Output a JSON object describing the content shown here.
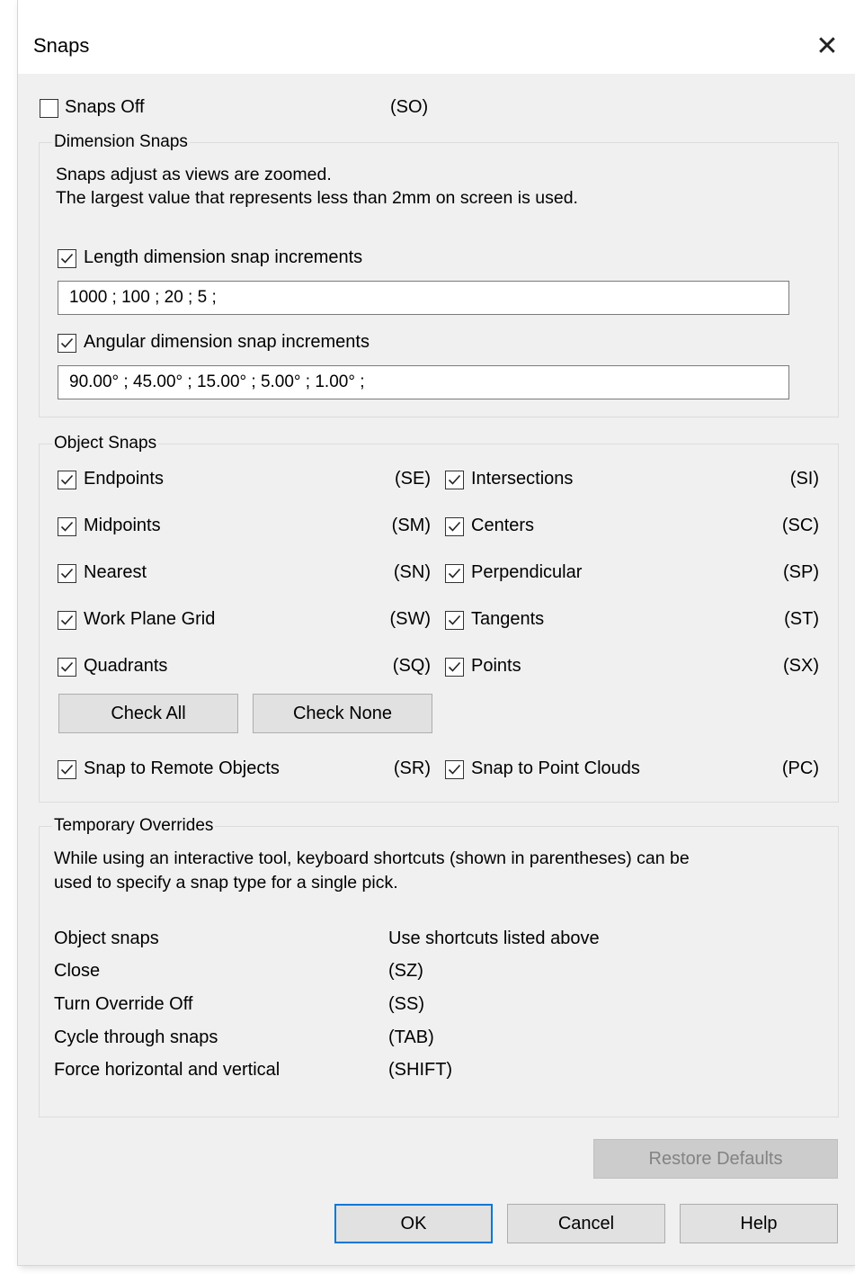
{
  "window": {
    "title": "Snaps",
    "close_glyph": "✕"
  },
  "snaps_off": {
    "label": "Snaps Off",
    "checked": false,
    "shortcut": "(SO)"
  },
  "dimension_snaps": {
    "title": "Dimension Snaps",
    "info_line1": "Snaps adjust as views are zoomed.",
    "info_line2": "The largest value that represents less than 2mm on screen is used.",
    "length": {
      "label": "Length dimension snap increments",
      "checked": true,
      "value": "1000 ; 100 ; 20 ; 5 ;"
    },
    "angular": {
      "label": "Angular dimension snap increments",
      "checked": true,
      "value": "90.00° ; 45.00° ; 15.00° ; 5.00° ; 1.00° ;"
    }
  },
  "object_snaps": {
    "title": "Object Snaps",
    "left": [
      {
        "label": "Endpoints",
        "shortcut": "(SE)",
        "checked": true
      },
      {
        "label": "Midpoints",
        "shortcut": "(SM)",
        "checked": true
      },
      {
        "label": "Nearest",
        "shortcut": "(SN)",
        "checked": true
      },
      {
        "label": "Work Plane Grid",
        "shortcut": "(SW)",
        "checked": true
      },
      {
        "label": "Quadrants",
        "shortcut": "(SQ)",
        "checked": true
      }
    ],
    "right": [
      {
        "label": "Intersections",
        "shortcut": "(SI)",
        "checked": true
      },
      {
        "label": "Centers",
        "shortcut": "(SC)",
        "checked": true
      },
      {
        "label": "Perpendicular",
        "shortcut": "(SP)",
        "checked": true
      },
      {
        "label": "Tangents",
        "shortcut": "(ST)",
        "checked": true
      },
      {
        "label": "Points",
        "shortcut": "(SX)",
        "checked": true
      }
    ],
    "check_all": "Check All",
    "check_none": "Check None",
    "remote": {
      "label": "Snap to Remote Objects",
      "shortcut": "(SR)",
      "checked": true
    },
    "point_clouds": {
      "label": "Snap to Point Clouds",
      "shortcut": "(PC)",
      "checked": true
    }
  },
  "temporary_overrides": {
    "title": "Temporary Overrides",
    "info_line1": "While using an interactive tool, keyboard shortcuts (shown in parentheses) can be",
    "info_line2": "used to specify a snap type for a single pick.",
    "rows": [
      {
        "name": "Object snaps",
        "value": "Use shortcuts listed above"
      },
      {
        "name": "Close",
        "value": "(SZ)"
      },
      {
        "name": "Turn Override Off",
        "value": "(SS)"
      },
      {
        "name": "Cycle through snaps",
        "value": "(TAB)"
      },
      {
        "name": "Force horizontal and vertical",
        "value": "(SHIFT)"
      }
    ]
  },
  "buttons": {
    "restore": "Restore Defaults",
    "ok": "OK",
    "cancel": "Cancel",
    "help": "Help"
  },
  "colors": {
    "dialog_bg": "#f0f0f0",
    "accent": "#0078d7",
    "disabled_text": "#838383"
  }
}
